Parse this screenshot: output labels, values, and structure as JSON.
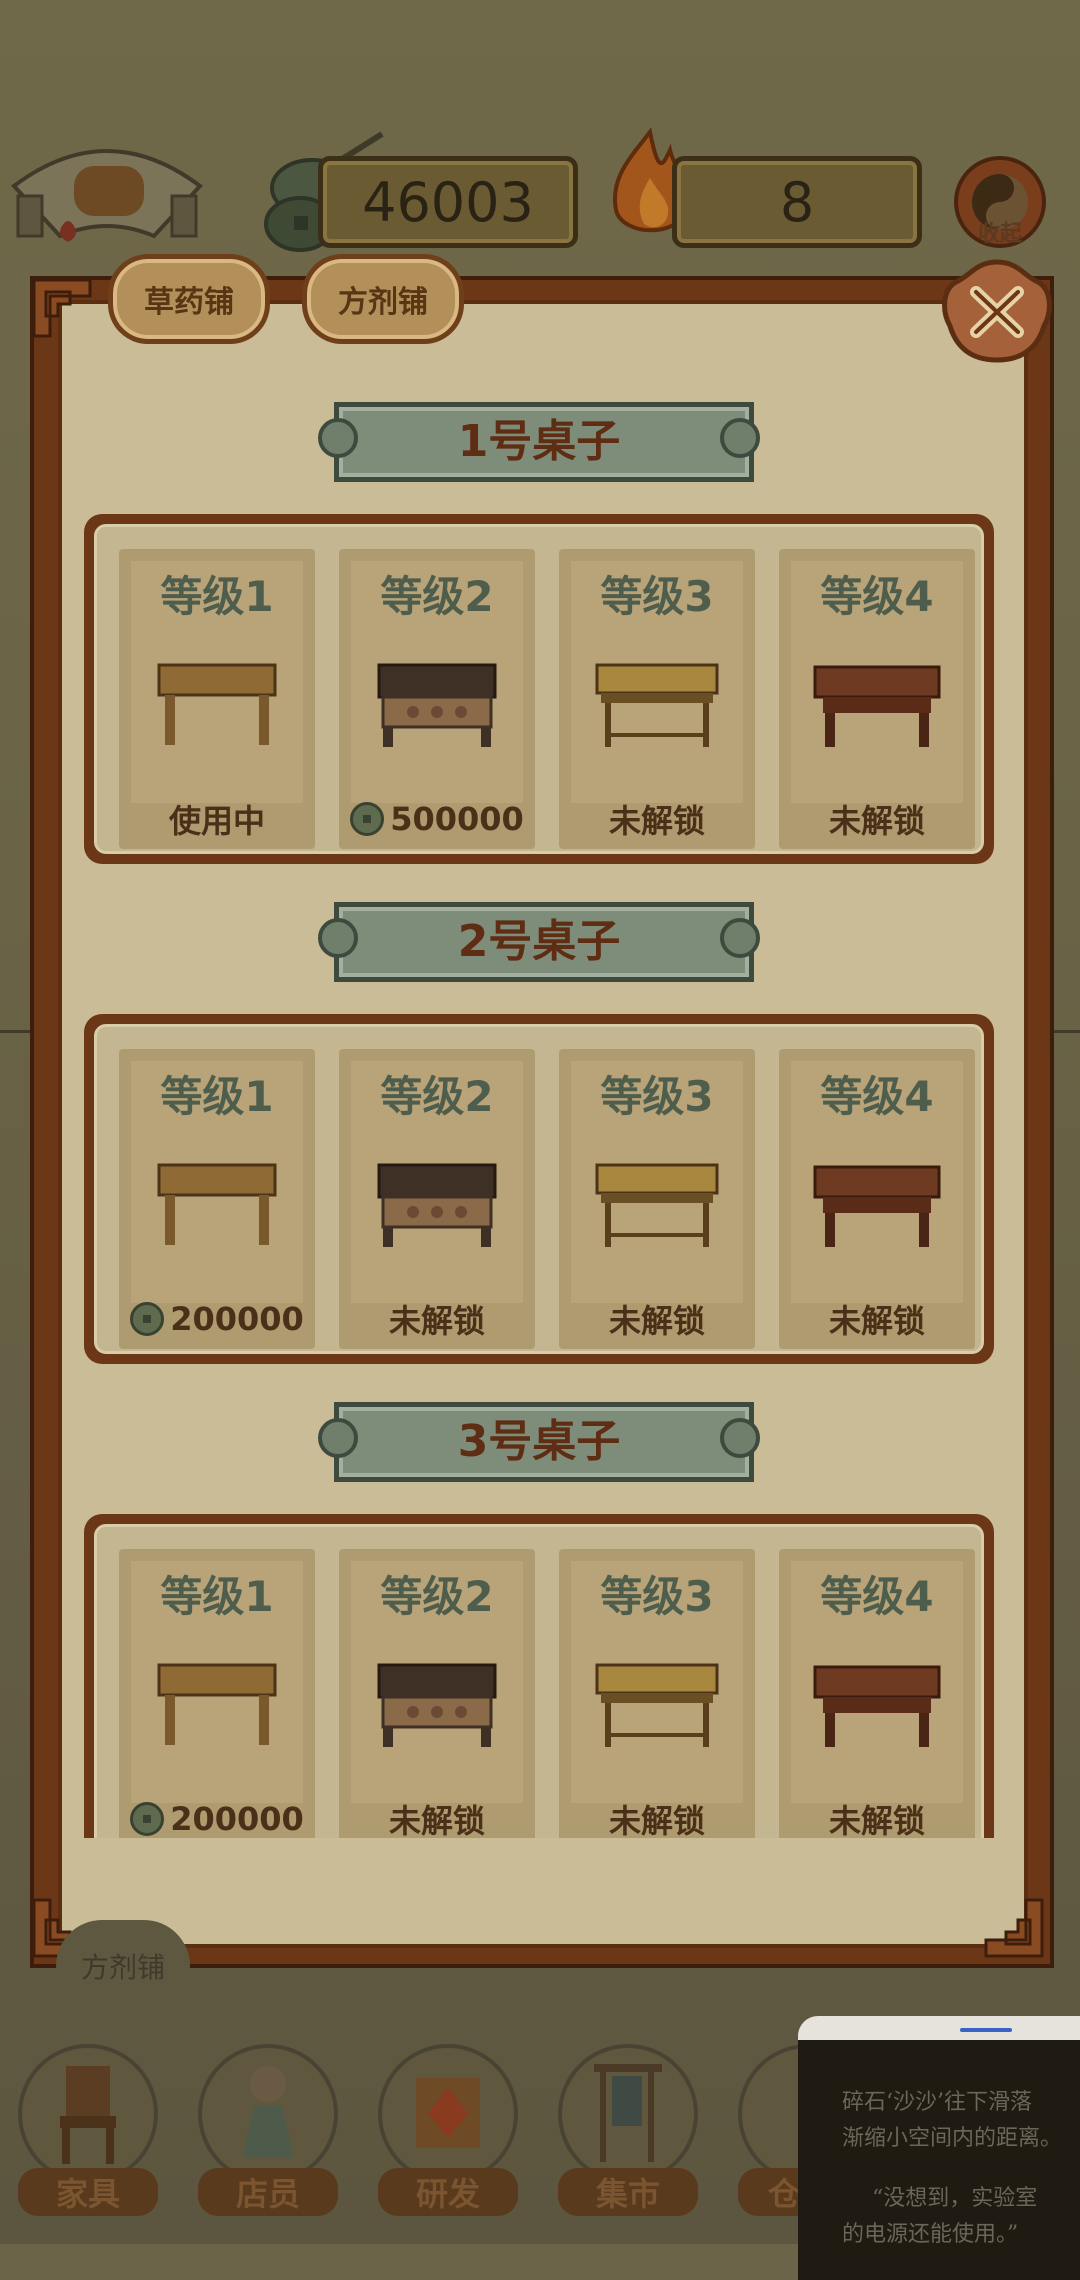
{
  "hud": {
    "coins": "46003",
    "fire": "8",
    "collapse_label": "收起"
  },
  "tabs": [
    {
      "label": "草药铺"
    },
    {
      "label": "方剂铺"
    }
  ],
  "tables": [
    {
      "title": "1号桌子",
      "cards": [
        {
          "level": "等级1",
          "status": "使用中"
        },
        {
          "level": "等级2",
          "price": "500000"
        },
        {
          "level": "等级3",
          "status": "未解锁"
        },
        {
          "level": "等级4",
          "status": "未解锁"
        }
      ]
    },
    {
      "title": "2号桌子",
      "cards": [
        {
          "level": "等级1",
          "price": "200000"
        },
        {
          "level": "等级2",
          "status": "未解锁"
        },
        {
          "level": "等级3",
          "status": "未解锁"
        },
        {
          "level": "等级4",
          "status": "未解锁"
        }
      ]
    },
    {
      "title": "3号桌子",
      "cards": [
        {
          "level": "等级1",
          "price": "200000"
        },
        {
          "level": "等级2",
          "status": "未解锁"
        },
        {
          "level": "等级3",
          "status": "未解锁"
        },
        {
          "level": "等级4",
          "status": "未解锁"
        }
      ]
    }
  ],
  "side_button": "方剂铺",
  "bottom_nav": [
    {
      "label": "家具",
      "icon": "chair-icon"
    },
    {
      "label": "店员",
      "icon": "clerk-icon"
    },
    {
      "label": "研发",
      "icon": "research-icon"
    },
    {
      "label": "集市",
      "icon": "market-icon"
    },
    {
      "label": "仓",
      "icon": "storage-icon"
    }
  ],
  "story": {
    "lines": [
      "碎石‘沙沙’往下滑落",
      "渐缩小空间内的距离。",
      "“没想到，实验室",
      "的电源还能使用。”"
    ]
  },
  "colors": {
    "frame": "#6b3717",
    "panel": "#c9bc97",
    "banner": "#7e8d7a",
    "dim_overlay": "#6b6449"
  }
}
